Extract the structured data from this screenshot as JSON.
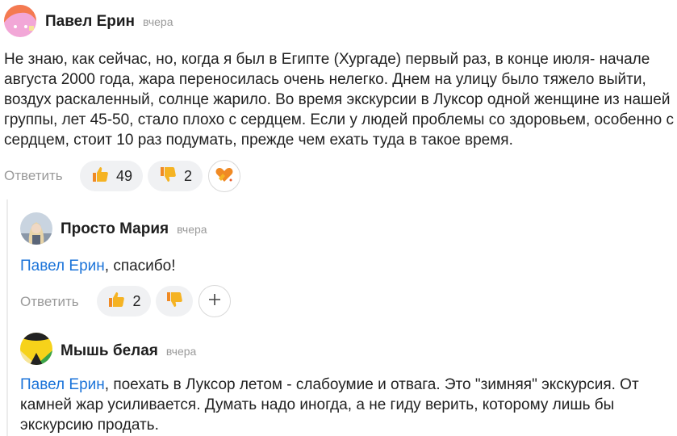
{
  "comments": [
    {
      "author": "Павел Ерин",
      "time": "вчера",
      "text": "Не знаю, как сейчас, но, когда я был в Египте (Хургаде) первый раз, в конце июля- начале августа 2000 года, жара переносилась очень нелегко. Днем на улицу было тяжело выйти, воздух раскаленный, солнце жарило. Во время экскурсии в Луксор одной женщине из нашей группы, лет 45-50, стало плохо с сердцем. Если у людей проблемы со здоровьем, особенно с сердцем, стоит 10 раз подумать, прежде чем ехать туда в такое время.",
      "reply_label": "Ответить",
      "likes": "49",
      "dislikes": "2"
    }
  ],
  "replies": [
    {
      "author": "Просто Мария",
      "time": "вчера",
      "mention": "Павел Ерин",
      "text": ", спасибо!",
      "reply_label": "Ответить",
      "likes": "2"
    },
    {
      "author": "Мышь белая",
      "time": "вчера",
      "mention": "Павел Ерин",
      "text": ", поехать в Луксор летом - слабоумие и отвага. Это \"зимняя\" экскурсия. От камней жар усиливается. Думать надо иногда, а не гиду верить, которому лишь бы экскурсию продать."
    }
  ],
  "icons": {
    "like": "thumbs-up-icon",
    "dislike": "thumbs-down-icon",
    "add_reaction": "plus-icon",
    "heart_hands": "heart-hands-icon"
  },
  "colors": {
    "mention": "#1a73d9",
    "reaction_orange": "#f5a623"
  }
}
